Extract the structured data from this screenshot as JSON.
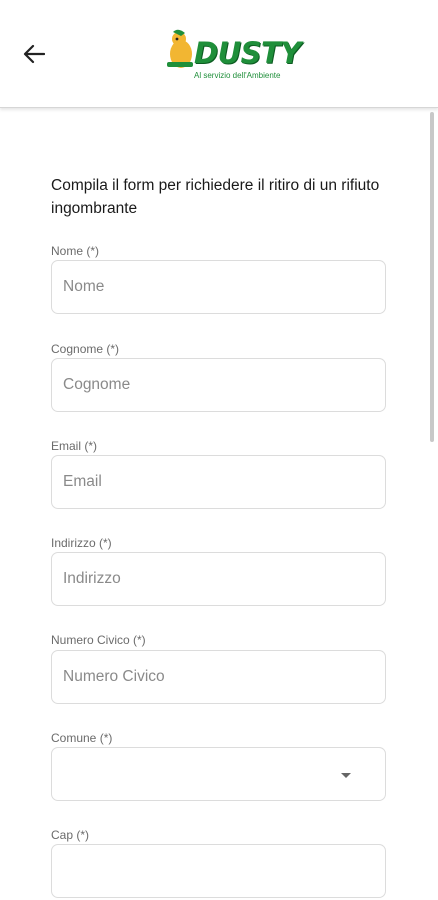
{
  "header": {
    "logo_text": "DUSTY",
    "logo_tagline": "Al servizio dell'Ambiente"
  },
  "form": {
    "intro": "Compila il form per richiedere il ritiro di un rifiuto ingombrante",
    "fields": [
      {
        "label": "Nome (*)",
        "placeholder": "Nome"
      },
      {
        "label": "Cognome (*)",
        "placeholder": "Cognome"
      },
      {
        "label": "Email (*)",
        "placeholder": "Email"
      },
      {
        "label": "Indirizzo (*)",
        "placeholder": "Indirizzo"
      },
      {
        "label": "Numero Civico (*)",
        "placeholder": "Numero Civico"
      },
      {
        "label": "Comune (*)",
        "value": ""
      },
      {
        "label": "Cap (*)",
        "placeholder": ""
      }
    ]
  },
  "colors": {
    "brand_green": "#1f8f3a",
    "field_border": "#dcdcdc"
  },
  "icons": {
    "back": "arrow-left-icon",
    "dropdown": "triangle-down-icon"
  }
}
